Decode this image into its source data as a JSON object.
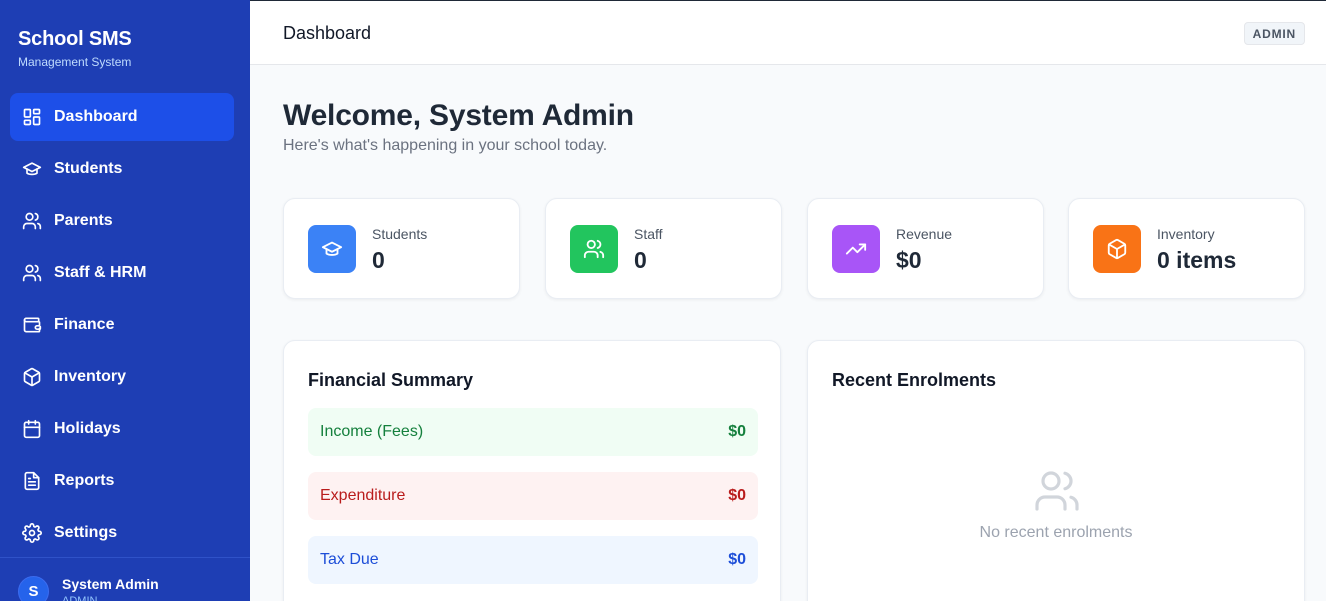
{
  "app": {
    "title": "School SMS",
    "subtitle": "Management System"
  },
  "sidebar": {
    "items": [
      {
        "label": "Dashboard",
        "icon": "grid-icon",
        "active": true
      },
      {
        "label": "Students",
        "icon": "graduation-cap-icon"
      },
      {
        "label": "Parents",
        "icon": "users-icon"
      },
      {
        "label": "Staff & HRM",
        "icon": "users-icon"
      },
      {
        "label": "Finance",
        "icon": "wallet-icon"
      },
      {
        "label": "Inventory",
        "icon": "box-icon"
      },
      {
        "label": "Holidays",
        "icon": "calendar-icon"
      },
      {
        "label": "Reports",
        "icon": "file-text-icon"
      },
      {
        "label": "Settings",
        "icon": "gear-icon"
      }
    ],
    "user": {
      "initial": "S",
      "name": "System Admin",
      "role": "ADMIN"
    }
  },
  "header": {
    "title": "Dashboard",
    "role_badge": "ADMIN"
  },
  "main": {
    "welcome": "Welcome, System Admin",
    "welcome_sub": "Here's what's happening in your school today.",
    "stats": [
      {
        "label": "Students",
        "value": "0",
        "icon": "graduation-cap-icon",
        "color": "#3b82f6"
      },
      {
        "label": "Staff",
        "value": "0",
        "icon": "users-icon",
        "color": "#22c55e"
      },
      {
        "label": "Revenue",
        "value": "$0",
        "icon": "trending-up-icon",
        "color": "#a855f7"
      },
      {
        "label": "Inventory",
        "value": "0 items",
        "icon": "box-icon",
        "color": "#f97316"
      }
    ],
    "financial_summary": {
      "title": "Financial Summary",
      "rows": [
        {
          "label": "Income (Fees)",
          "value": "$0",
          "bg": "#f0fdf4",
          "color": "#15803d"
        },
        {
          "label": "Expenditure",
          "value": "$0",
          "bg": "#fef2f2",
          "color": "#b91c1c"
        },
        {
          "label": "Tax Due",
          "value": "$0",
          "bg": "#eff6ff",
          "color": "#1d4ed8"
        }
      ]
    },
    "recent_enrolments": {
      "title": "Recent Enrolments",
      "empty_text": "No recent enrolments"
    }
  }
}
